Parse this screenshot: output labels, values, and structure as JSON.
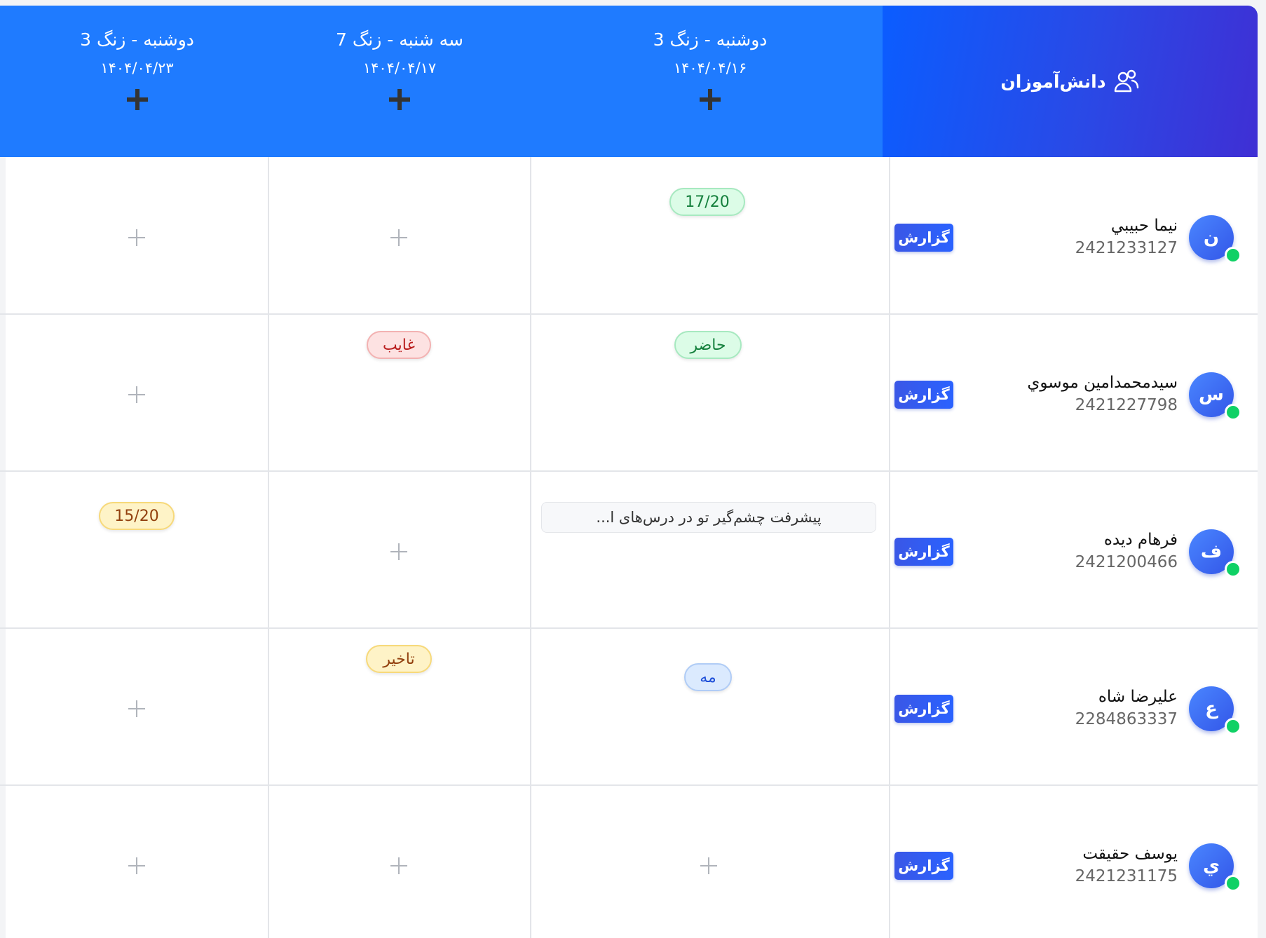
{
  "header": {
    "students_label": "دانش‌آموزان",
    "sessions": [
      {
        "title": "دوشنبه - زنگ 3",
        "date": "۱۴۰۴/۰۴/۱۶"
      },
      {
        "title": "سه شنبه - زنگ 7",
        "date": "۱۴۰۴/۰۴/۱۷"
      },
      {
        "title": "دوشنبه - زنگ 3",
        "date": "۱۴۰۴/۰۴/۲۳"
      }
    ]
  },
  "report_label": "گزارش",
  "students": [
    {
      "initial": "ن",
      "name": "نیما حبیبي",
      "id": "2421233127"
    },
    {
      "initial": "س",
      "name": "سیدمحمدامین موسوي",
      "id": "2421227798"
    },
    {
      "initial": "ف",
      "name": "فرهام دیده",
      "id": "2421200466"
    },
    {
      "initial": "ع",
      "name": "علیرضا شاه",
      "id": "2284863337"
    },
    {
      "initial": "ي",
      "name": "یوسف حقیقت",
      "id": "2421231175"
    }
  ],
  "entries": {
    "r1_s1": "17/20",
    "r2_s1": "حاضر",
    "r2_s2": "غایب",
    "r3_s1": "پیشرفت چشم‌گیر تو در درس‌های ا...",
    "r3_s3": "15/20",
    "r4_s1": "مه",
    "r4_s2": "تاخیر"
  },
  "colors": {
    "header_blue": "#1f7bff",
    "accent_gradient_start": "#0b5dff",
    "accent_gradient_end": "#3f2fd4",
    "online": "#10d165"
  },
  "icons": {
    "students": "students-group-icon",
    "add": "plus-icon",
    "online": "online-status-dot"
  }
}
